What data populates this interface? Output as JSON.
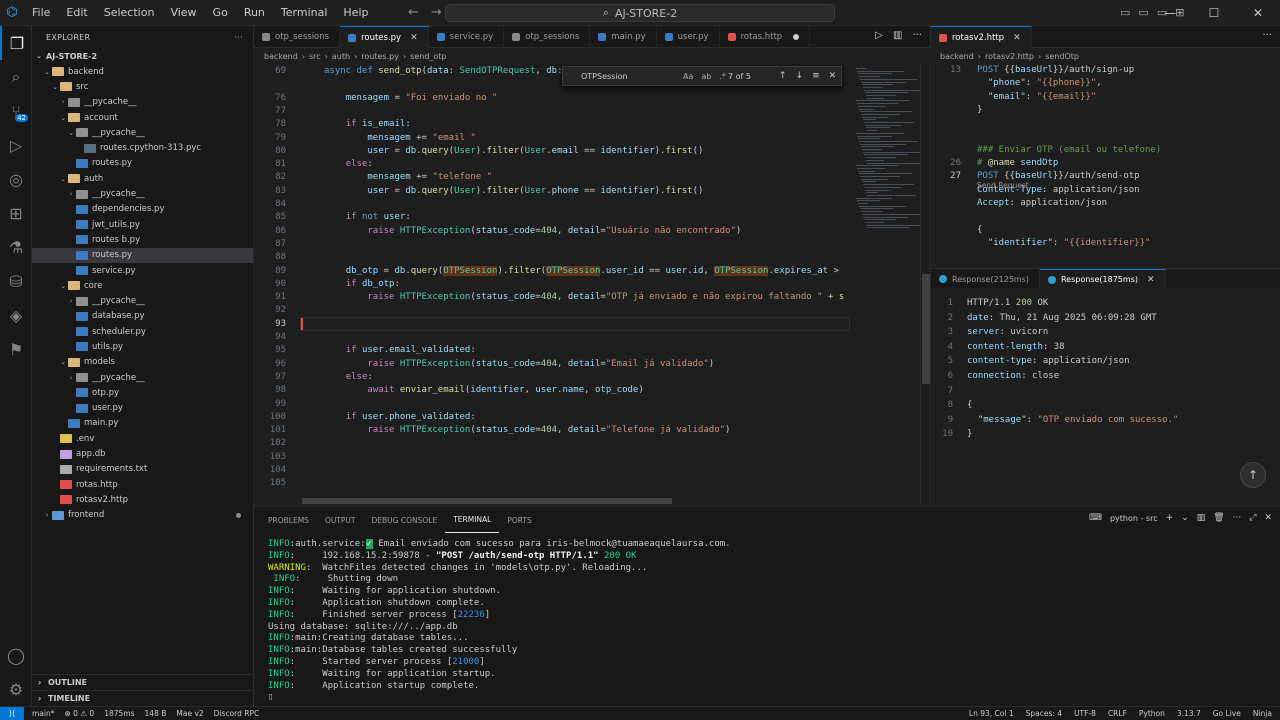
{
  "app": {
    "workspace": "AJ-STORE-2",
    "menu": [
      "File",
      "Edit",
      "Selection",
      "View",
      "Go",
      "Run",
      "Terminal",
      "Help"
    ]
  },
  "explorer": {
    "title": "EXPLORER",
    "root": "AJ-STORE-2",
    "items": [
      {
        "label": "backend",
        "kind": "folder-open",
        "indent": 1
      },
      {
        "label": "src",
        "kind": "folder-open",
        "indent": 2
      },
      {
        "label": "__pycache__",
        "kind": "folder",
        "indent": 3
      },
      {
        "label": "account",
        "kind": "folder-open",
        "indent": 3
      },
      {
        "label": "__pycache__",
        "kind": "folder-open",
        "indent": 4
      },
      {
        "label": "routes.cpython-313.pyc",
        "kind": "pyc",
        "indent": 5
      },
      {
        "label": "routes.py",
        "kind": "py",
        "indent": 4
      },
      {
        "label": "auth",
        "kind": "folder-open",
        "indent": 3
      },
      {
        "label": "__pycache__",
        "kind": "folder",
        "indent": 4
      },
      {
        "label": "dependencies.py",
        "kind": "py",
        "indent": 4
      },
      {
        "label": "jwt_utils.py",
        "kind": "py",
        "indent": 4
      },
      {
        "label": "routes b.py",
        "kind": "py",
        "indent": 4
      },
      {
        "label": "routes.py",
        "kind": "py",
        "indent": 4,
        "selected": true
      },
      {
        "label": "service.py",
        "kind": "py",
        "indent": 4
      },
      {
        "label": "core",
        "kind": "folder-open",
        "indent": 3
      },
      {
        "label": "__pycache__",
        "kind": "folder",
        "indent": 4
      },
      {
        "label": "database.py",
        "kind": "py",
        "indent": 4
      },
      {
        "label": "scheduler.py",
        "kind": "py",
        "indent": 4
      },
      {
        "label": "utils.py",
        "kind": "py",
        "indent": 4
      },
      {
        "label": "models",
        "kind": "folder-open",
        "indent": 3
      },
      {
        "label": "__pycache__",
        "kind": "folder",
        "indent": 4
      },
      {
        "label": "otp.py",
        "kind": "py",
        "indent": 4
      },
      {
        "label": "user.py",
        "kind": "py",
        "indent": 4
      },
      {
        "label": "main.py",
        "kind": "py",
        "indent": 3
      },
      {
        "label": ".env",
        "kind": "env",
        "indent": 2
      },
      {
        "label": "app.db",
        "kind": "db",
        "indent": 2
      },
      {
        "label": "requirements.txt",
        "kind": "txt",
        "indent": 2
      },
      {
        "label": "rotas.http",
        "kind": "http",
        "indent": 2
      },
      {
        "label": "rotasv2.http",
        "kind": "http",
        "indent": 2
      },
      {
        "label": "frontend",
        "kind": "folder-blue",
        "indent": 1,
        "dot": true
      }
    ],
    "outline": "OUTLINE",
    "timeline": "TIMELINE"
  },
  "tabs": [
    {
      "label": "otp_sessions",
      "icon": "#888888"
    },
    {
      "label": "routes.py",
      "icon": "#3b7bbf",
      "active": true
    },
    {
      "label": "service.py",
      "icon": "#3b7bbf"
    },
    {
      "label": "otp_sessions",
      "icon": "#888888"
    },
    {
      "label": "main.py",
      "icon": "#3b7bbf"
    },
    {
      "label": "user.py",
      "icon": "#3b7bbf"
    },
    {
      "label": "rotas.http",
      "icon": "#e05050",
      "modified": true
    }
  ],
  "breadcrumb": [
    "backend",
    "src",
    "auth",
    "routes.py",
    "send_otp"
  ],
  "find": {
    "query": "OTPSession",
    "count": "7 of 5"
  },
  "editor_lines": [
    {
      "n": "69",
      "html": "<span class='kw2'>async</span> <span class='kw2'>def</span> <span class='fn'>send_otp</span>(<span class='var'>data</span>: <span class='cls'>SendOTPRequest</span>, <span class='var'>db</span>:"
    },
    {
      "n": "",
      "html": ""
    },
    {
      "n": "76",
      "html": "    <span class='var'>mensagem</span> = <span class='str'>\"Foi enviado no \"</span>"
    },
    {
      "n": "77",
      "html": ""
    },
    {
      "n": "78",
      "html": "    <span class='kw'>if</span> <span class='var'>is_email</span>:"
    },
    {
      "n": "79",
      "html": "        <span class='var'>mensagem</span> += <span class='str'>\"email \"</span>"
    },
    {
      "n": "80",
      "html": "        <span class='var'>user</span> = <span class='var'>db</span>.<span class='fn'>query</span>(<span class='cls'>User</span>).<span class='fn'>filter</span>(<span class='cls'>User</span>.<span class='var'>email</span> == <span class='var'>identifier</span>).<span class='fn'>first</span>()"
    },
    {
      "n": "81",
      "html": "    <span class='kw'>else</span>:"
    },
    {
      "n": "82",
      "html": "        <span class='var'>mensagem</span> += <span class='str'>\"telefone \"</span>"
    },
    {
      "n": "83",
      "html": "        <span class='var'>user</span> = <span class='var'>db</span>.<span class='fn'>query</span>(<span class='cls'>User</span>).<span class='fn'>filter</span>(<span class='cls'>User</span>.<span class='var'>phone</span> == <span class='var'>identifier</span>).<span class='fn'>first</span>()"
    },
    {
      "n": "84",
      "html": ""
    },
    {
      "n": "85",
      "html": "    <span class='kw'>if</span> <span class='kw2'>not</span> <span class='var'>user</span>:"
    },
    {
      "n": "86",
      "html": "        <span class='kw'>raise</span> <span class='cls'>HTTPException</span>(<span class='var'>status_code</span>=<span class='num'>404</span>, <span class='var'>detail</span>=<span class='str'>\"Usuário não encontrado\"</span>)"
    },
    {
      "n": "87",
      "html": ""
    },
    {
      "n": "88",
      "html": ""
    },
    {
      "n": "89",
      "html": "    <span class='var'>db_otp</span> = <span class='var'>db</span>.<span class='fn'>query</span>(<span class='cls hl'>OTPSession</span>).<span class='fn'>filter</span>(<span class='cls hl'>OTPSession</span>.<span class='var'>user_id</span> == <span class='var'>user</span>.<span class='var'>id</span>, <span class='cls hl'>OTPSession</span>.<span class='var'>expires_at</span> >"
    },
    {
      "n": "90",
      "html": "    <span class='kw'>if</span> <span class='var'>db_otp</span>:"
    },
    {
      "n": "91",
      "html": "        <span class='kw'>raise</span> <span class='cls'>HTTPException</span>(<span class='var'>status_code</span>=<span class='num'>404</span>, <span class='var'>detail</span>=<span class='str'>\"OTP já enviado e não expirou faltando \"</span> + <span class='fn'>s</span>"
    },
    {
      "n": "92",
      "html": ""
    },
    {
      "n": "93",
      "html": "",
      "current": true
    },
    {
      "n": "94",
      "html": ""
    },
    {
      "n": "95",
      "html": "    <span class='kw'>if</span> <span class='var'>user</span>.<span class='var'>email_validated</span>:"
    },
    {
      "n": "96",
      "html": "        <span class='kw'>raise</span> <span class='cls'>HTTPException</span>(<span class='var'>status_code</span>=<span class='num'>404</span>, <span class='var'>detail</span>=<span class='str'>\"Email já validado\"</span>)"
    },
    {
      "n": "97",
      "html": "    <span class='kw'>else</span>:"
    },
    {
      "n": "98",
      "html": "        <span class='kw'>await</span> <span class='fn'>enviar_email</span>(<span class='var'>identifier</span>, <span class='var'>user</span>.<span class='var'>name</span>, <span class='var'>otp_code</span>)"
    },
    {
      "n": "99",
      "html": ""
    },
    {
      "n": "100",
      "html": "    <span class='kw'>if</span> <span class='var'>user</span>.<span class='var'>phone_validated</span>:"
    },
    {
      "n": "101",
      "html": "        <span class='kw'>raise</span> <span class='cls'>HTTPException</span>(<span class='var'>status_code</span>=<span class='num'>404</span>, <span class='var'>detail</span>=<span class='str'>\"Telefone já validado\"</span>)"
    },
    {
      "n": "102",
      "html": ""
    },
    {
      "n": "103",
      "html": ""
    },
    {
      "n": "104",
      "html": ""
    },
    {
      "n": "105",
      "html": ""
    }
  ],
  "right": {
    "tab": "rotasv2.http",
    "breadcrumb": [
      "backend",
      "rotasv2.http",
      "sendOtp"
    ],
    "lines": [
      {
        "n": "13",
        "html": "<span class='hlin'>POST</span> {{<span class='var'>baseUrl</span>}}/auth/sign-up"
      },
      {
        "n": "",
        "html": "  <span class='rkey'>\"phone\"</span>: <span class='rval'>\"{{phone}}\"</span>,"
      },
      {
        "n": "",
        "html": "  <span class='rkey'>\"email\"</span>: <span class='rval'>\"{{email}}\"</span>"
      },
      {
        "n": "",
        "html": "}"
      },
      {
        "n": "",
        "html": ""
      },
      {
        "n": "",
        "html": ""
      },
      {
        "n": "",
        "html": "<span class='comment'>### Enviar OTP (email ou telefone)</span>"
      },
      {
        "n": "26",
        "html": "<span class='comment'># </span><span class='fn'>@name</span> <span class='var'>sendOtp</span>"
      },
      {
        "n": "27",
        "html": "<span class='hlin'>POST</span> {{<span class='var'>baseUrl</span>}}/auth/send-otp",
        "current": true
      },
      {
        "n": "",
        "html": "<span class='rkey'>Content-Type</span>: application/json"
      },
      {
        "n": "",
        "html": "<span class='rkey'>Accept</span>: application/json"
      },
      {
        "n": "",
        "html": ""
      },
      {
        "n": "",
        "html": "{"
      },
      {
        "n": "",
        "html": "  <span class='rkey'>\"identifier\"</span>: <span class='rval'>\"{{identifier}}\"</span>"
      }
    ],
    "codelens": "Send Request",
    "response_tabs": [
      "Response(2125ms)",
      "Response(1875ms)"
    ],
    "response": [
      {
        "n": "1",
        "html": "HTTP/1.1 <span class='rstat'>200</span> OK"
      },
      {
        "n": "2",
        "html": "<span class='rkey'>date</span>: Thu, 21 Aug 2025 06:09:28 GMT"
      },
      {
        "n": "3",
        "html": "<span class='rkey'>server</span>: uvicorn"
      },
      {
        "n": "4",
        "html": "<span class='rkey'>content-length</span>: 38"
      },
      {
        "n": "5",
        "html": "<span class='rkey'>content-type</span>: application/json"
      },
      {
        "n": "6",
        "html": "<span class='rkey'>connection</span>: close"
      },
      {
        "n": "7",
        "html": ""
      },
      {
        "n": "8",
        "html": "{"
      },
      {
        "n": "9",
        "html": "  <span class='rkey'>\"message\"</span>: <span class='rval'>\"OTP enviado com sucesso.\"</span>"
      },
      {
        "n": "10",
        "html": "}"
      }
    ]
  },
  "panel": {
    "tabs": [
      "PROBLEMS",
      "OUTPUT",
      "DEBUG CONSOLE",
      "TERMINAL",
      "PORTS"
    ],
    "active": "TERMINAL",
    "terminal_name": "python - src",
    "lines": [
      "<span class='tinfo'>INFO</span>:auth.service:<span class='tcheck'>✓</span> Email enviado com sucesso para iris-belmock@tuamaeaquelaursa.com.",
      "<span class='tinfo'>INFO</span>:     192.168.15.2:59878 - <span class='tpath'>\"POST /auth/send-otp HTTP/1.1\"</span> <span class='tstat'>200 OK</span>",
      "<span class='twarn'>WARNING</span>:  WatchFiles detected changes in 'models\\otp.py'. Reloading...",
      " <span class='tinfo'>INFO</span>:     Shutting down",
      "<span class='tinfo'>INFO</span>:     Waiting for application shutdown.",
      "<span class='tinfo'>INFO</span>:     Application shutdown complete.",
      "<span class='tinfo'>INFO</span>:     Finished server process [<span class='tnum'>22236</span>]",
      "Using database: sqlite:///../app.db",
      "<span class='tinfo'>INFO</span>:main:Creating database tables...",
      "<span class='tinfo'>INFO</span>:main:Database tables created successfully",
      "<span class='tinfo'>INFO</span>:     Started server process [<span class='tnum'>21000</span>]",
      "<span class='tinfo'>INFO</span>:     Waiting for application startup.",
      "<span class='tinfo'>INFO</span>:     Application startup complete.",
      "▯"
    ]
  },
  "status": {
    "branch": "main*",
    "problems": "⊗ 0 ⚠ 0",
    "time": "1875ms",
    "size": "148 B",
    "mode": "Mae v2",
    "discord": "Discord RPC",
    "cursor": "Ln 93, Col 1",
    "spaces": "Spaces: 4",
    "encoding": "UTF-8",
    "eol": "CRLF",
    "language": "Python",
    "version": "3.13.7",
    "golive": "Go Live",
    "ninja": "Ninja"
  }
}
